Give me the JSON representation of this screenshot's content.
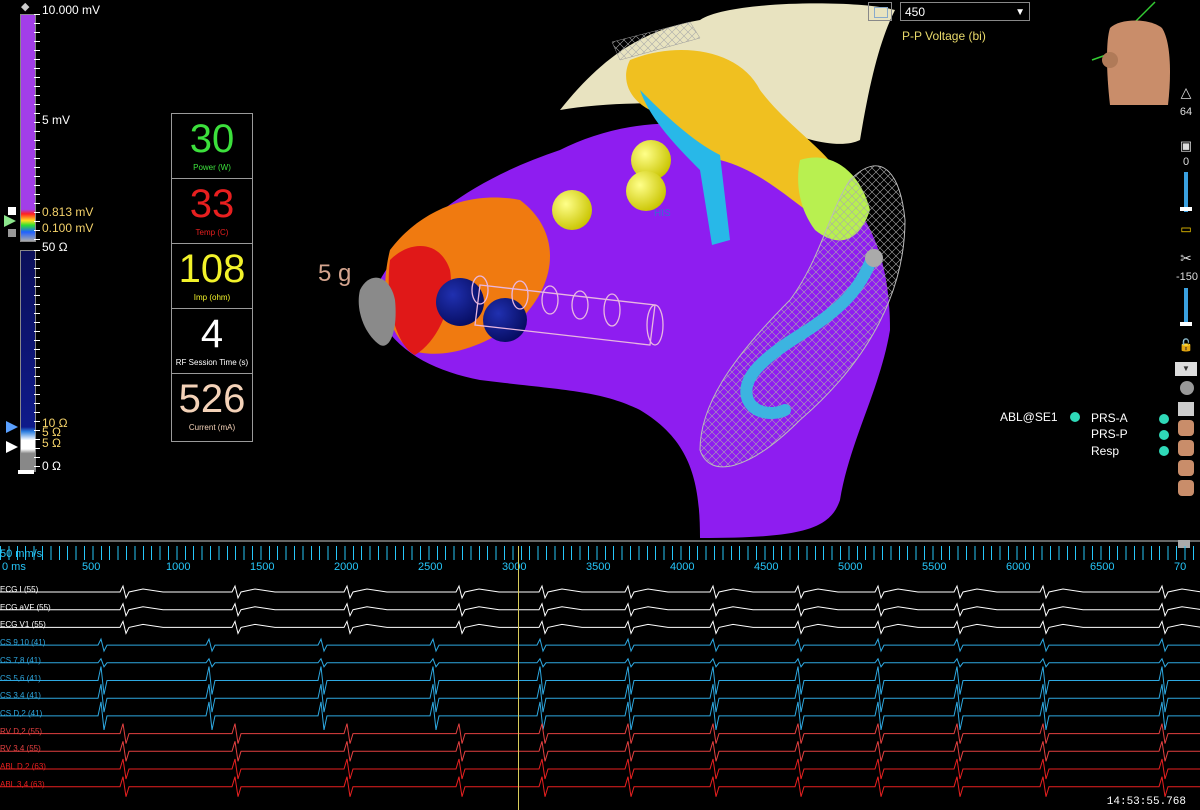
{
  "voltage_scale": {
    "top": "10.000 mV",
    "mid": "5 mV",
    "upper_threshold": "0.813 mV",
    "lower_threshold": "0.100 mV"
  },
  "impedance_scale": {
    "top": "50 Ω",
    "t1": "10 Ω",
    "t2": "5 Ω",
    "t3": "5 Ω",
    "bottom": "0 Ω"
  },
  "rf_panel": [
    {
      "value": "30",
      "label": "Power (W)",
      "color": "#3ce03c"
    },
    {
      "value": "33",
      "label": "Temp (C)",
      "color": "#e81f1f"
    },
    {
      "value": "108",
      "label": "Imp (ohm)",
      "color": "#f2f22a"
    },
    {
      "value": "4",
      "label": "RF Session Time (s)",
      "color": "#ffffff"
    },
    {
      "value": "526",
      "label": "Current (mA)",
      "color": "#f4d2b8"
    }
  ],
  "contact_force": "5 g",
  "his_label": "HIS",
  "map_dropdown": {
    "value": "450"
  },
  "map_type": "P-P Voltage (bi)",
  "toolbar": {
    "transparency": "64",
    "v1": "0",
    "v2": "-150"
  },
  "resp_panel": {
    "abl": "ABL@SE1",
    "items": [
      "PRS-A",
      "PRS-P",
      "Resp"
    ]
  },
  "ruler": {
    "speed": "50 mm/s",
    "start": "0 ms",
    "ticks": [
      "500",
      "1000",
      "1500",
      "2000",
      "2500",
      "3000",
      "3500",
      "4000",
      "4500",
      "5000",
      "5500",
      "6000",
      "6500",
      "70"
    ]
  },
  "channels": [
    {
      "label": "ECG I (55)",
      "color": "#ffffff"
    },
    {
      "label": "ECG aVF (55)",
      "color": "#ffffff"
    },
    {
      "label": "ECG V1 (55)",
      "color": "#ffffff"
    },
    {
      "label": "CS 9,10 (41)",
      "color": "#2ea8e0"
    },
    {
      "label": "CS 7,8 (41)",
      "color": "#2ea8e0"
    },
    {
      "label": "CS 5,6 (41)",
      "color": "#2ea8e0"
    },
    {
      "label": "CS 3,4 (41)",
      "color": "#2ea8e0"
    },
    {
      "label": "CS D,2 (41)",
      "color": "#2ea8e0"
    },
    {
      "label": "RV D,2 (55)",
      "color": "#e24040"
    },
    {
      "label": "RV 3,4 (55)",
      "color": "#e24040"
    },
    {
      "label": "ABL D,2 (63)",
      "color": "#e82020"
    },
    {
      "label": "ABL 3,4 (63)",
      "color": "#e82020"
    }
  ],
  "timestamp": "14:53:55.768"
}
